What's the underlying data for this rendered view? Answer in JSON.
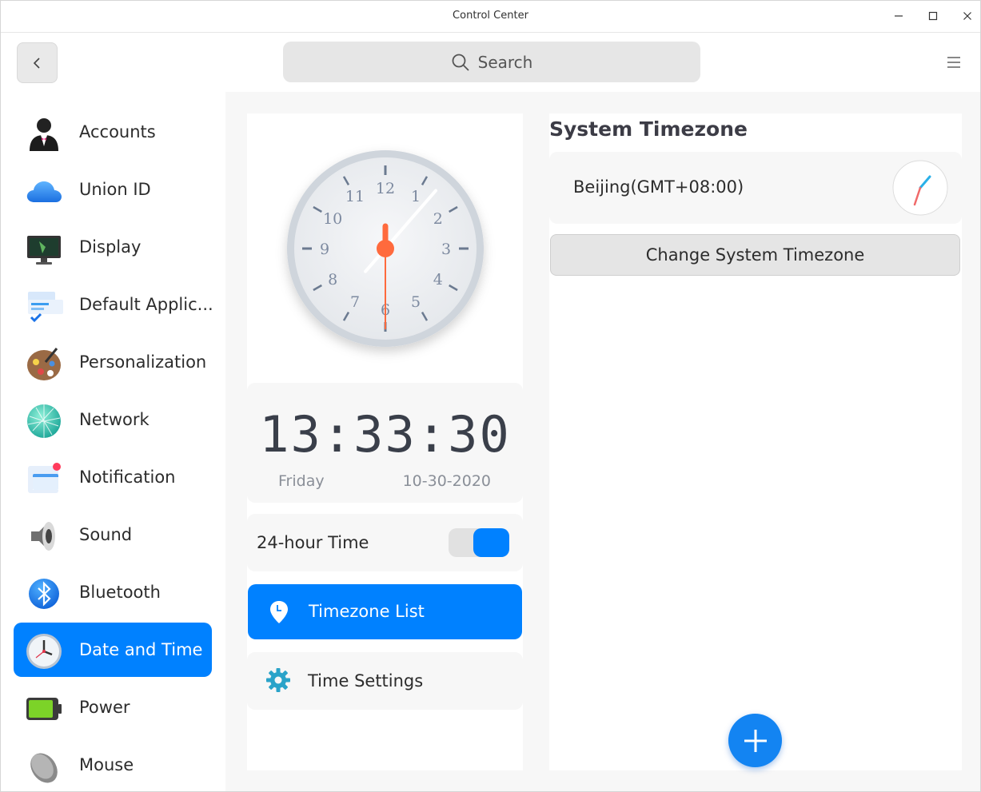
{
  "window": {
    "title": "Control Center"
  },
  "search": {
    "placeholder": "Search"
  },
  "sidebar": {
    "items": [
      {
        "label": "Accounts",
        "icon": "accounts-icon"
      },
      {
        "label": "Union ID",
        "icon": "cloud-icon"
      },
      {
        "label": "Display",
        "icon": "display-icon"
      },
      {
        "label": "Default Applic...",
        "icon": "default-apps-icon"
      },
      {
        "label": "Personalization",
        "icon": "palette-icon"
      },
      {
        "label": "Network",
        "icon": "network-icon"
      },
      {
        "label": "Notification",
        "icon": "notification-icon"
      },
      {
        "label": "Sound",
        "icon": "speaker-icon"
      },
      {
        "label": "Bluetooth",
        "icon": "bluetooth-icon"
      },
      {
        "label": "Date and Time",
        "icon": "clock-icon",
        "active": true
      },
      {
        "label": "Power",
        "icon": "battery-icon"
      },
      {
        "label": "Mouse",
        "icon": "mouse-icon"
      }
    ]
  },
  "clock": {
    "digital": "13:33:30",
    "weekday": "Friday",
    "date": "10-30-2020",
    "hour": 13,
    "minute": 33,
    "second": 30
  },
  "settings": {
    "hour24_label": "24-hour Time",
    "hour24_on": true,
    "timezone_list_label": "Timezone List",
    "time_settings_label": "Time Settings"
  },
  "timezone": {
    "section_title": "System Timezone",
    "current": "Beijing(GMT+08:00)",
    "change_label": "Change System Timezone"
  },
  "colors": {
    "accent": "#0081ff",
    "second_hand": "#ff6a3d"
  }
}
